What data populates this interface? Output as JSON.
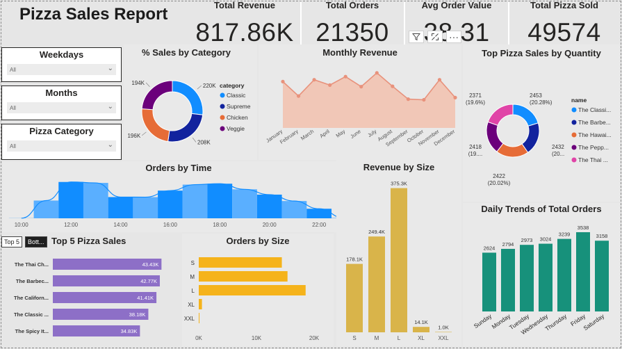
{
  "report_title": "Pizza Sales Report",
  "kpis": [
    {
      "label": "Total Revenue",
      "value": "817.86K"
    },
    {
      "label": "Total Orders",
      "value": "21350"
    },
    {
      "label": "Avg Order Value",
      "value": "38.31"
    },
    {
      "label": "Total Pizza Sold",
      "value": "49574"
    }
  ],
  "slicers": [
    {
      "title": "Weekdays",
      "value": "All"
    },
    {
      "title": "Months",
      "value": "All"
    },
    {
      "title": "Pizza Category",
      "value": "All"
    }
  ],
  "visual_header": {
    "filter_icon": "filter-icon",
    "focus_icon": "focus-mode-icon",
    "more_icon": "more-options-icon"
  },
  "top_bottom_buttons": {
    "top": "Top 5",
    "bottom": "Bott..."
  },
  "colors": {
    "classic": "#118dff",
    "supreme": "#12239e",
    "chicken": "#e66c37",
    "veggie": "#6b007b",
    "thai": "#e044a7",
    "line_area": "#e8927c",
    "orders_time": "#118dff",
    "size_bar": "#f5b31b",
    "revenue_size": "#d9b44a",
    "top5": "#8d6fc7",
    "daily": "#17917b"
  },
  "chart_data": [
    {
      "id": "sales-by-category",
      "type": "pie",
      "title": "% Sales by Category",
      "legend_title": "category",
      "legend_position": "right",
      "categories": [
        "Classic",
        "Supreme",
        "Chicken",
        "Veggie"
      ],
      "values": [
        220,
        208,
        196,
        194
      ],
      "data_labels": [
        "220K",
        "208K",
        "196K",
        "194K"
      ]
    },
    {
      "id": "monthly-revenue",
      "type": "area",
      "title": "Monthly Revenue",
      "categories": [
        "January",
        "February",
        "March",
        "April",
        "May",
        "June",
        "July",
        "August",
        "September",
        "October",
        "November",
        "December"
      ],
      "values": [
        69.8,
        65.2,
        70.4,
        68.7,
        71.4,
        68.2,
        72.6,
        68.3,
        64.2,
        64.0,
        70.4,
        64.7
      ],
      "ylim": [
        55,
        75
      ]
    },
    {
      "id": "top-pizza-by-quantity",
      "type": "pie",
      "title": "Top Pizza Sales by Quantity",
      "legend_title": "name",
      "legend_position": "right",
      "categories": [
        "The Classi...",
        "The Barbe...",
        "The Hawai...",
        "The Pepp...",
        "The Thai ..."
      ],
      "values": [
        2453,
        2432,
        2422,
        2418,
        2371
      ],
      "data_labels": [
        {
          "value": "2453",
          "pct": "(20.28%)"
        },
        {
          "value": "2432",
          "pct": "(20..."
        },
        {
          "value": "2422",
          "pct": "(20.02%)"
        },
        {
          "value": "2418",
          "pct": "(19...."
        },
        {
          "value": "2371",
          "pct": "(19.6%)"
        }
      ]
    },
    {
      "id": "orders-by-time",
      "type": "area",
      "title": "Orders by Time",
      "x_ticks": [
        "10:00",
        "12:00",
        "14:00",
        "16:00",
        "18:00",
        "20:00",
        "22:00"
      ],
      "x": [
        10,
        11,
        12,
        13,
        14,
        15,
        16,
        17,
        18,
        19,
        20,
        21,
        22,
        23
      ],
      "values": [
        8,
        1231,
        2520,
        2455,
        1472,
        1468,
        1920,
        2336,
        2399,
        2009,
        1642,
        1198,
        663,
        28
      ],
      "xlim": [
        9.7,
        23.2
      ],
      "ylim": [
        0,
        2700
      ]
    },
    {
      "id": "revenue-by-size",
      "type": "bar",
      "title": "Revenue by Size",
      "categories": [
        "S",
        "M",
        "L",
        "XL",
        "XXL"
      ],
      "values": [
        178.1,
        249.4,
        375.3,
        14.1,
        1.0
      ],
      "data_labels": [
        "178.1K",
        "249.4K",
        "375.3K",
        "14.1K",
        "1.0K"
      ],
      "ylim": [
        0,
        380
      ]
    },
    {
      "id": "daily-trends",
      "type": "bar",
      "title": "Daily Trends of Total Orders",
      "categories": [
        "Sunday",
        "Monday",
        "Tuesday",
        "Wednesday",
        "Thursday",
        "Friday",
        "Saturday"
      ],
      "values": [
        2624,
        2794,
        2973,
        3024,
        3239,
        3538,
        3158
      ],
      "ylim": [
        0,
        3600
      ]
    },
    {
      "id": "top-5-pizza-sales",
      "type": "bar",
      "title": "Top 5 Pizza Sales",
      "categories": [
        "The Thai Ch...",
        "The Barbec...",
        "The Californ...",
        "The Classic ...",
        "The Spicy It..."
      ],
      "values": [
        43.43,
        42.77,
        41.41,
        38.18,
        34.83
      ],
      "data_labels": [
        "43.43K",
        "42.77K",
        "41.41K",
        "38.18K",
        "34.83K"
      ],
      "xlim": [
        0,
        45
      ]
    },
    {
      "id": "orders-by-size",
      "type": "bar",
      "title": "Orders by Size",
      "categories": [
        "S",
        "M",
        "L",
        "XL",
        "XXL"
      ],
      "values": [
        14403,
        15385,
        18526,
        552,
        28
      ],
      "x_ticks": [
        "0K",
        "10K",
        "20K"
      ],
      "xlim": [
        0,
        20000
      ]
    }
  ]
}
